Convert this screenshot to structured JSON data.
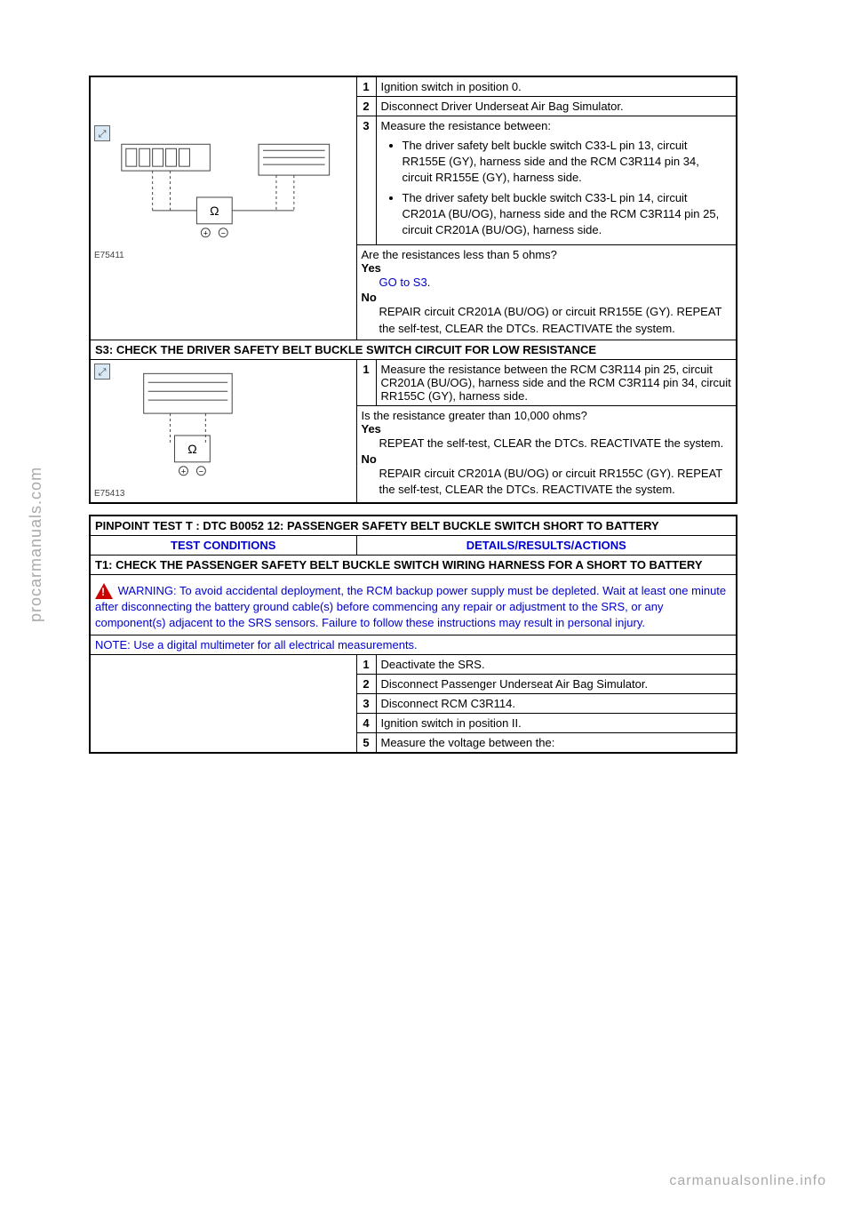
{
  "watermarks": {
    "left": "procarmanuals.com",
    "bottom": "carmanualsonline.info"
  },
  "s2": {
    "row1": "Ignition switch in position 0.",
    "row2": "Disconnect Driver Underseat Air Bag Simulator.",
    "row3_lead": "Measure the resistance between:",
    "row3_b1": "The driver safety belt buckle switch C33-L pin 13, circuit RR155E (GY), harness side and the RCM C3R114 pin 34, circuit RR155E (GY), harness side.",
    "row3_b2": "The driver safety belt buckle switch C33-L pin 14, circuit CR201A (BU/OG), harness side and the RCM C3R114 pin 25, circuit CR201A (BU/OG), harness side.",
    "question": "Are the resistances less than 5 ohms?",
    "yes_link": "GO to S3",
    "no_text": "REPAIR circuit CR201A (BU/OG) or circuit RR155E (GY). REPEAT the self-test, CLEAR the DTCs. REACTIVATE the system.",
    "diag_label": "E75411"
  },
  "s3": {
    "title": "S3: CHECK THE DRIVER SAFETY BELT BUCKLE SWITCH CIRCUIT FOR LOW RESISTANCE",
    "row1": "Measure the resistance between the RCM C3R114 pin 25, circuit CR201A (BU/OG), harness side and the RCM C3R114 pin 34, circuit RR155C (GY), harness side.",
    "question": "Is the resistance greater than 10,000 ohms?",
    "yes_text": "REPEAT the self-test, CLEAR the DTCs. REACTIVATE the system.",
    "no_text": "REPAIR circuit CR201A (BU/OG) or circuit RR155C (GY). REPEAT the self-test, CLEAR the DTCs. REACTIVATE the system.",
    "diag_label": "E75413"
  },
  "pinpoint_t": {
    "title": "PINPOINT TEST T : DTC B0052 12: PASSENGER SAFETY BELT BUCKLE SWITCH SHORT TO BATTERY",
    "col1": "TEST CONDITIONS",
    "col2": "DETAILS/RESULTS/ACTIONS",
    "t1_title": "T1: CHECK THE PASSENGER SAFETY BELT BUCKLE SWITCH WIRING HARNESS FOR A SHORT TO BATTERY",
    "warning": "WARNING: To avoid accidental deployment, the RCM backup power supply must be depleted. Wait at least one minute after disconnecting the battery ground cable(s) before commencing any repair or adjustment to the SRS, or any component(s) adjacent to the SRS sensors. Failure to follow these instructions may result in personal injury.",
    "note": "NOTE: Use a digital multimeter for all electrical measurements.",
    "row1": "Deactivate the SRS.",
    "row2": "Disconnect Passenger Underseat Air Bag Simulator.",
    "row3": "Disconnect RCM C3R114.",
    "row4": "Ignition switch in position II.",
    "row5": "Measure the voltage between the:"
  },
  "labels": {
    "yes": "Yes",
    "no": "No"
  }
}
